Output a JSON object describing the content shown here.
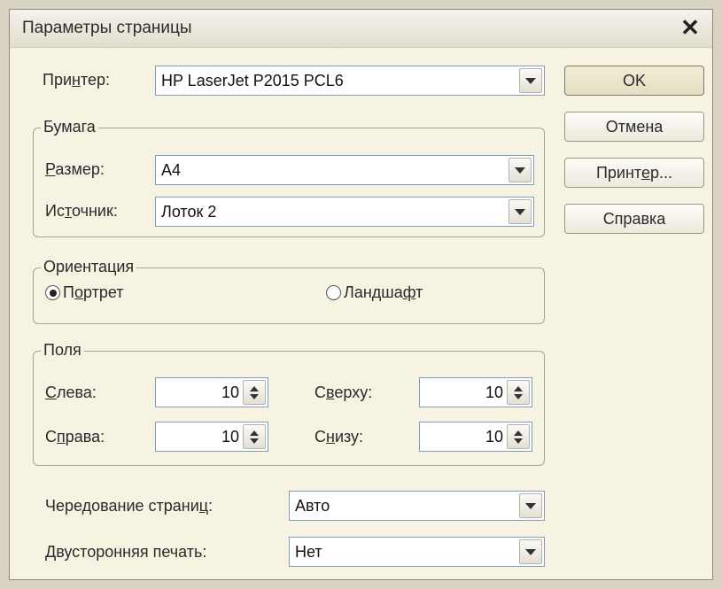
{
  "window": {
    "title": "Параметры страницы",
    "close_glyph": "✕"
  },
  "printer": {
    "label_pre": "При",
    "label_u": "н",
    "label_post": "тер:",
    "value": "HP LaserJet P2015 PCL6"
  },
  "buttons": {
    "ok": "OK",
    "cancel": "Отмена",
    "printer_pre": "Принт",
    "printer_u": "е",
    "printer_post": "р...",
    "help": "Справка"
  },
  "paper": {
    "legend": "Бумага",
    "size_u": "Р",
    "size_post": "азмер:",
    "size_value": "A4",
    "source_pre": "Ис",
    "source_u": "т",
    "source_post": "очник:",
    "source_value": "Лоток 2"
  },
  "orientation": {
    "legend": "Ориентация",
    "portrait_pre": "П",
    "portrait_u": "о",
    "portrait_post": "ртрет",
    "landscape_pre": "Ландша",
    "landscape_u": "ф",
    "landscape_post": "т",
    "selected": "portrait"
  },
  "margins": {
    "legend": "Поля",
    "left_u": "С",
    "left_post": "лева:",
    "left_value": "10",
    "right_pre": "С",
    "right_u": "п",
    "right_post": "рава:",
    "right_value": "10",
    "top_pre": "С",
    "top_u": "в",
    "top_post": "ерху:",
    "top_value": "10",
    "bottom_pre": "С",
    "bottom_u": "н",
    "bottom_post": "изу:",
    "bottom_value": "10"
  },
  "alternation": {
    "label_pre": "Чередование страни",
    "label_u": "ц",
    "label_post": ":",
    "value": "Авто"
  },
  "duplex": {
    "label": "Двусторонняя печать:",
    "value": "Нет"
  }
}
